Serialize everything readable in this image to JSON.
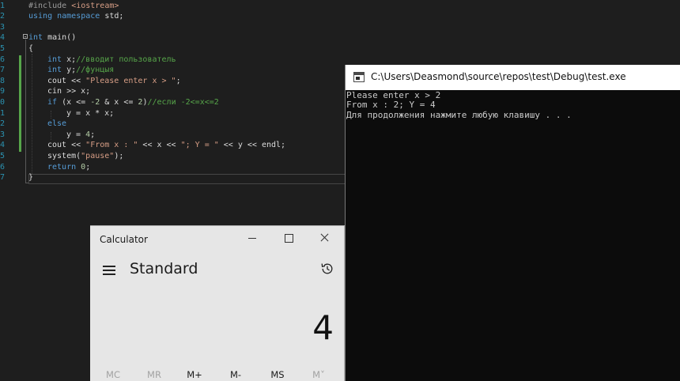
{
  "editor": {
    "lines": [
      {
        "n": "1",
        "indent": 0,
        "tokens": [
          {
            "t": "#include ",
            "c": "pp"
          },
          {
            "t": "<iostream>",
            "c": "inc"
          }
        ]
      },
      {
        "n": "2",
        "indent": 0,
        "tokens": [
          {
            "t": "using ",
            "c": "kw"
          },
          {
            "t": "namespace ",
            "c": "kw"
          },
          {
            "t": "std;",
            "c": ""
          }
        ]
      },
      {
        "n": "3",
        "indent": 0,
        "tokens": []
      },
      {
        "n": "4",
        "indent": 0,
        "tokens": [
          {
            "t": "int ",
            "c": "kw"
          },
          {
            "t": "main()",
            "c": ""
          }
        ]
      },
      {
        "n": "5",
        "indent": 0,
        "tokens": [
          {
            "t": "{",
            "c": ""
          }
        ]
      },
      {
        "n": "6",
        "indent": 1,
        "tokens": [
          {
            "t": "int ",
            "c": "kw"
          },
          {
            "t": "x;",
            "c": ""
          },
          {
            "t": "//вводит пользователь",
            "c": "cmt"
          }
        ]
      },
      {
        "n": "7",
        "indent": 1,
        "tokens": [
          {
            "t": "int ",
            "c": "kw"
          },
          {
            "t": "y;",
            "c": ""
          },
          {
            "t": "//фунцыя",
            "c": "cmt"
          }
        ]
      },
      {
        "n": "8",
        "indent": 1,
        "tokens": [
          {
            "t": "cout << ",
            "c": ""
          },
          {
            "t": "\"Please enter x > \"",
            "c": "str"
          },
          {
            "t": ";",
            "c": ""
          }
        ]
      },
      {
        "n": "9",
        "indent": 1,
        "tokens": [
          {
            "t": "cin >> x;",
            "c": ""
          }
        ]
      },
      {
        "n": "0",
        "indent": 1,
        "tokens": [
          {
            "t": "if ",
            "c": "kw"
          },
          {
            "t": "(x <= ",
            "c": ""
          },
          {
            "t": "-2",
            "c": "num"
          },
          {
            "t": " & x <= ",
            "c": ""
          },
          {
            "t": "2",
            "c": "num"
          },
          {
            "t": ")",
            "c": ""
          },
          {
            "t": "//если -2<=x<=2",
            "c": "cmt"
          }
        ]
      },
      {
        "n": "1",
        "indent": 2,
        "tokens": [
          {
            "t": "y = x * x;",
            "c": ""
          }
        ]
      },
      {
        "n": "2",
        "indent": 1,
        "tokens": [
          {
            "t": "else",
            "c": "kw"
          }
        ]
      },
      {
        "n": "3",
        "indent": 2,
        "tokens": [
          {
            "t": "y = ",
            "c": ""
          },
          {
            "t": "4",
            "c": "num"
          },
          {
            "t": ";",
            "c": ""
          }
        ]
      },
      {
        "n": "4",
        "indent": 1,
        "tokens": [
          {
            "t": "cout << ",
            "c": ""
          },
          {
            "t": "\"From x : \"",
            "c": "str"
          },
          {
            "t": " << x << ",
            "c": ""
          },
          {
            "t": "\"; Y = \"",
            "c": "str"
          },
          {
            "t": " << y << endl;",
            "c": ""
          }
        ]
      },
      {
        "n": "5",
        "indent": 1,
        "tokens": [
          {
            "t": "system(",
            "c": ""
          },
          {
            "t": "\"pause\"",
            "c": "str"
          },
          {
            "t": ");",
            "c": ""
          }
        ]
      },
      {
        "n": "6",
        "indent": 1,
        "tokens": [
          {
            "t": "return ",
            "c": "kw"
          },
          {
            "t": "0",
            "c": "num"
          },
          {
            "t": ";",
            "c": ""
          }
        ]
      },
      {
        "n": "7",
        "indent": 0,
        "tokens": [
          {
            "t": "}",
            "c": ""
          }
        ]
      }
    ]
  },
  "console": {
    "title": "C:\\Users\\Deasmond\\source\\repos\\test\\Debug\\test.exe",
    "lines": [
      "Please enter x > 2",
      "From x : 2; Y = 4",
      "Для продолжения нажмите любую клавишу . . ."
    ]
  },
  "calculator": {
    "title": "Calculator",
    "mode": "Standard",
    "display": "4",
    "memory_buttons": [
      {
        "label": "MC",
        "enabled": false
      },
      {
        "label": "MR",
        "enabled": false
      },
      {
        "label": "M+",
        "enabled": true
      },
      {
        "label": "M-",
        "enabled": true
      },
      {
        "label": "MS",
        "enabled": true
      },
      {
        "label": "M˅",
        "enabled": false
      }
    ]
  },
  "colors": {
    "editor_bg": "#1e1e1e",
    "keyword": "#569cd6",
    "string": "#d69d85",
    "comment": "#57a64a",
    "number": "#b5cea8",
    "console_bg": "#0c0c0c",
    "calc_bg": "#e6e6e6"
  }
}
